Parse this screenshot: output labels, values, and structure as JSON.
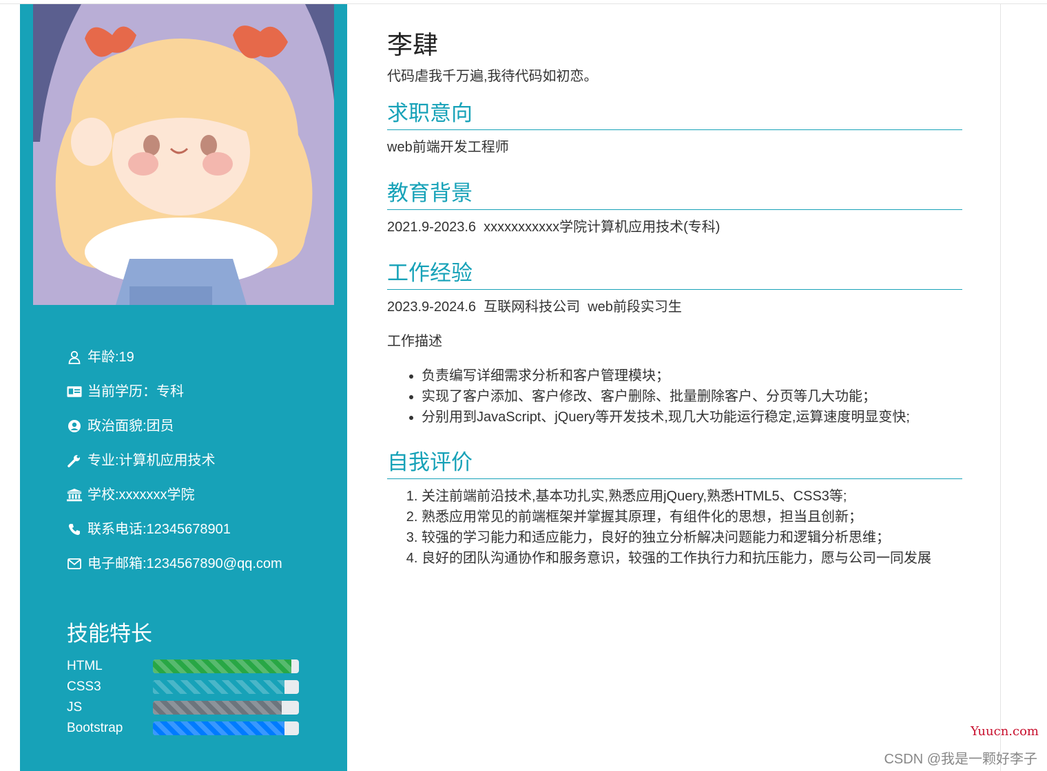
{
  "profile": {
    "name": "李肆",
    "motto": "代码虐我千万遍,我待代码如初恋。"
  },
  "sidebar": {
    "info": [
      {
        "icon": "user-icon",
        "text": "年龄:19"
      },
      {
        "icon": "id-card-icon",
        "text": "当前学历：专科"
      },
      {
        "icon": "user-circle-icon",
        "text": "政治面貌:团员"
      },
      {
        "icon": "wrench-icon",
        "text": "专业:计算机应用技术"
      },
      {
        "icon": "institution-icon",
        "text": "学校:xxxxxxx学院"
      },
      {
        "icon": "phone-icon",
        "text": "联系电话:12345678901"
      },
      {
        "icon": "envelope-icon",
        "text": "电子邮箱:1234567890@qq.com"
      }
    ],
    "skills_title": "技能特长",
    "skills": [
      {
        "label": "HTML",
        "level": 0.95,
        "color": "#28a745"
      },
      {
        "label": "CSS3",
        "level": 0.9,
        "color": "#17a2b8"
      },
      {
        "label": "JS",
        "level": 0.88,
        "color": "#6c757d"
      },
      {
        "label": "Bootstrap",
        "level": 0.9,
        "color": "#007bff"
      }
    ]
  },
  "sections": {
    "intent": {
      "title": "求职意向",
      "text": "web前端开发工程师"
    },
    "education": {
      "title": "教育背景",
      "text": "2021.9-2023.6  xxxxxxxxxxx学院计算机应用技术(专科)"
    },
    "work": {
      "title": "工作经验",
      "text": "2023.9-2024.6  互联网科技公司  web前段实习生",
      "desc_label": "工作描述",
      "items": [
        "负责编写详细需求分析和客户管理模块；",
        "实现了客户添加、客户修改、客户删除、批量删除客户、分页等几大功能；",
        "分别用到JavaScript、jQuery等开发技术,现几大功能运行稳定,运算速度明显变快;"
      ]
    },
    "self": {
      "title": "自我评价",
      "items": [
        "关注前端前沿技术,基本功扎实,熟悉应用jQuery,熟悉HTML5、CSS3等;",
        "熟悉应用常见的前端框架并掌握其原理，有组件化的思想，担当且创新；",
        "较强的学习能力和适应能力，良好的独立分析解决问题能力和逻辑分析思维；",
        "良好的团队沟通协作和服务意识，较强的工作执行力和抗压能力，愿与公司一同发展"
      ]
    }
  },
  "watermarks": {
    "site": "Yuucn.com",
    "csdn": "CSDN @我是一颗好李子"
  }
}
